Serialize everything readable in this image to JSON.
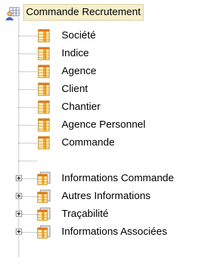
{
  "tree": {
    "root": {
      "label": "Commande Recrutement",
      "icon": "user-table-icon"
    },
    "items": [
      {
        "label": "Société",
        "icon": "table-icon",
        "expandable": false
      },
      {
        "label": "Indice",
        "icon": "table-icon",
        "expandable": false
      },
      {
        "label": "Agence",
        "icon": "table-icon",
        "expandable": false
      },
      {
        "label": "Client",
        "icon": "table-icon",
        "expandable": false
      },
      {
        "label": "Chantier",
        "icon": "table-icon",
        "expandable": false
      },
      {
        "label": "Agence Personnel",
        "icon": "table-icon",
        "expandable": false
      },
      {
        "label": "Commande",
        "icon": "table-icon",
        "expandable": false
      },
      {
        "label": "Informations Commande",
        "icon": "table-group-icon",
        "expandable": true
      },
      {
        "label": "Autres Informations",
        "icon": "table-group-icon",
        "expandable": true
      },
      {
        "label": "Traçabilité",
        "icon": "table-group-icon",
        "expandable": true
      },
      {
        "label": "Informations Associées",
        "icon": "table-group-icon",
        "expandable": true
      }
    ]
  },
  "colors": {
    "selection_bg": "#f6f0cd",
    "table_orange": "#f5a623",
    "group_gray": "#bdbdbd",
    "tree_line": "#9a9a9a"
  }
}
